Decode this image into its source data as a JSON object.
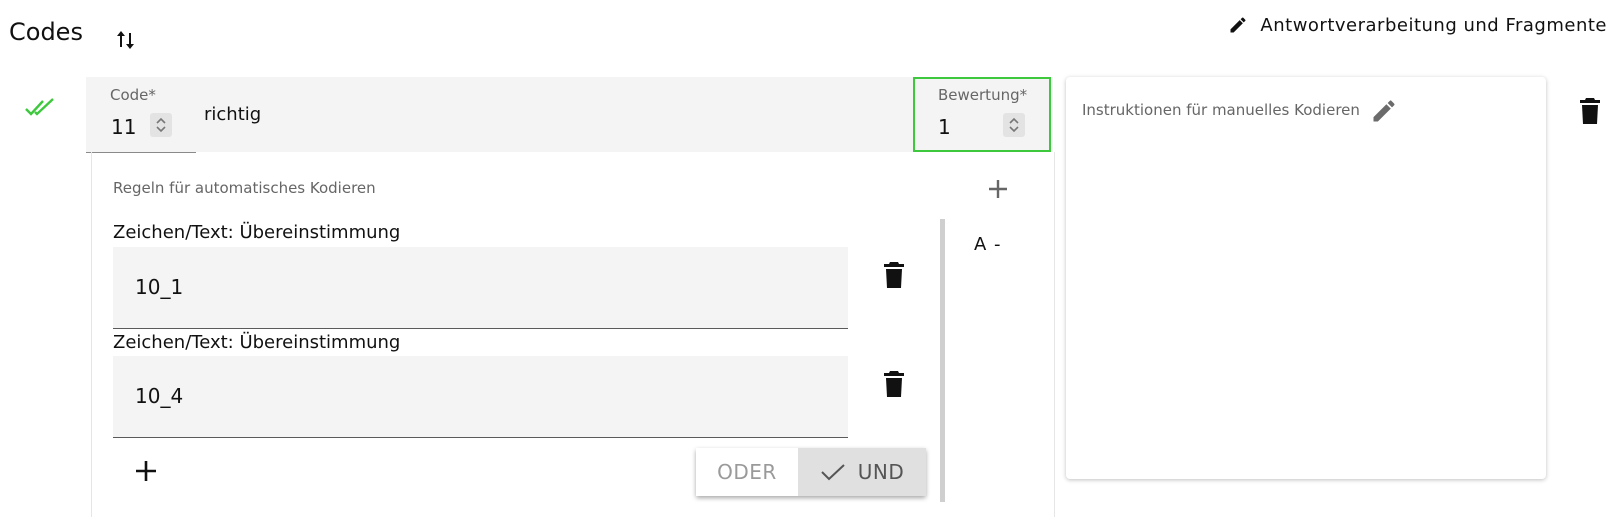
{
  "page": {
    "title": "Codes"
  },
  "header": {
    "link_label": "Antwortverarbeitung und Fragmente"
  },
  "code": {
    "label": "Code*",
    "value": "11",
    "text": "richtig",
    "score_label": "Bewertung*",
    "score_value": "1"
  },
  "rules": {
    "title": "Regeln für automatisches Kodieren",
    "items": [
      {
        "label": "Zeichen/Text: Übereinstimmung",
        "value": "10_1"
      },
      {
        "label": "Zeichen/Text: Übereinstimmung",
        "value": "10_4"
      }
    ],
    "side_text": "A -",
    "operator_options": [
      "ODER",
      "UND"
    ],
    "operator_selected": "UND"
  },
  "manual": {
    "title": "Instruktionen für manuelles Kodieren"
  },
  "colors": {
    "check": "#3ec83e",
    "accent_border": "#3ec83e"
  },
  "icons": [
    "sort-icon",
    "pencil-icon",
    "double-check-icon",
    "spinner-icon",
    "plus-icon",
    "trash-icon",
    "check-icon"
  ]
}
